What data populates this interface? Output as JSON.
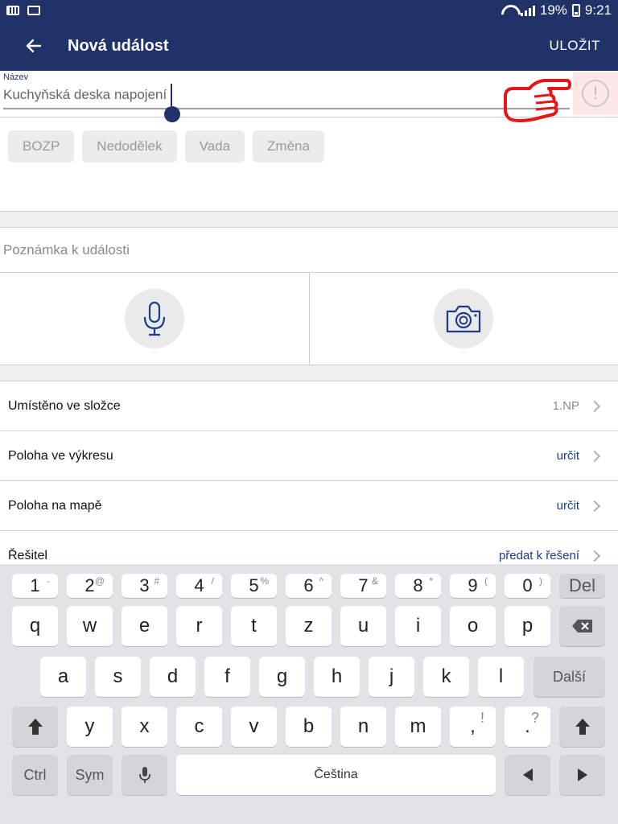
{
  "status_bar": {
    "battery": "19%",
    "time": "9:21"
  },
  "app_bar": {
    "title": "Nová událost",
    "save_label": "ULOŽIT"
  },
  "name_field": {
    "label": "Název",
    "value": "Kuchyňská deska napojení"
  },
  "chips": [
    "BOZP",
    "Nedodělek",
    "Vada",
    "Změna"
  ],
  "note": {
    "placeholder": "Poznámka k události"
  },
  "list": [
    {
      "label": "Umístěno ve složce",
      "value": "1.NP",
      "link": false
    },
    {
      "label": "Poloha ve výkresu",
      "value": "určit",
      "link": true
    },
    {
      "label": "Poloha na mapě",
      "value": "určit",
      "link": true
    },
    {
      "label": "Řešitel",
      "value": "předat k řešení",
      "link": true
    }
  ],
  "keyboard": {
    "number_row": [
      {
        "k": "1",
        "s": "-"
      },
      {
        "k": "2",
        "s": "@"
      },
      {
        "k": "3",
        "s": "#"
      },
      {
        "k": "4",
        "s": "/"
      },
      {
        "k": "5",
        "s": "%"
      },
      {
        "k": "6",
        "s": "^"
      },
      {
        "k": "7",
        "s": "&"
      },
      {
        "k": "8",
        "s": "*"
      },
      {
        "k": "9",
        "s": "("
      },
      {
        "k": "0",
        "s": ")"
      }
    ],
    "del_label": "Del",
    "row1": [
      "q",
      "w",
      "e",
      "r",
      "t",
      "z",
      "u",
      "i",
      "o",
      "p"
    ],
    "row2": [
      "a",
      "s",
      "d",
      "f",
      "g",
      "h",
      "j",
      "k",
      "l"
    ],
    "next_label": "Další",
    "row3": [
      "y",
      "x",
      "c",
      "v",
      "b",
      "n",
      "m"
    ],
    "comma_key": {
      "k": ",",
      "s": "!"
    },
    "period_key": {
      "k": ".",
      "s": "?"
    },
    "ctrl_label": "Ctrl",
    "sym_label": "Sym",
    "space_label": "Čeština"
  }
}
